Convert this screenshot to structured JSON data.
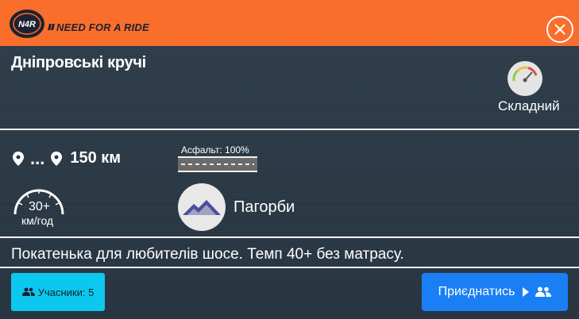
{
  "header": {
    "logo_badge_text": "N4R",
    "logo_text": "NEED FOR A RIDE",
    "close_icon": "close-circle-icon",
    "color": "#fa6e2c"
  },
  "ride": {
    "title": "Дніпровські кручі",
    "difficulty": "Складний",
    "route_from": "...",
    "distance": "150 км",
    "surface": "Асфальт: 100%",
    "speed_value": "30+",
    "speed_unit": "км/год",
    "terrain": "Пагорби",
    "description": "Покатенька для любителів шосе. Темп 40+ без матрасу."
  },
  "actions": {
    "participants_label": "Учасники: 5",
    "join_label": "Приєднатись"
  },
  "colors": {
    "participants_button": "#0cc8ee",
    "join_button": "#1a7ff5",
    "terrain_icon": "#4b4f9b"
  }
}
